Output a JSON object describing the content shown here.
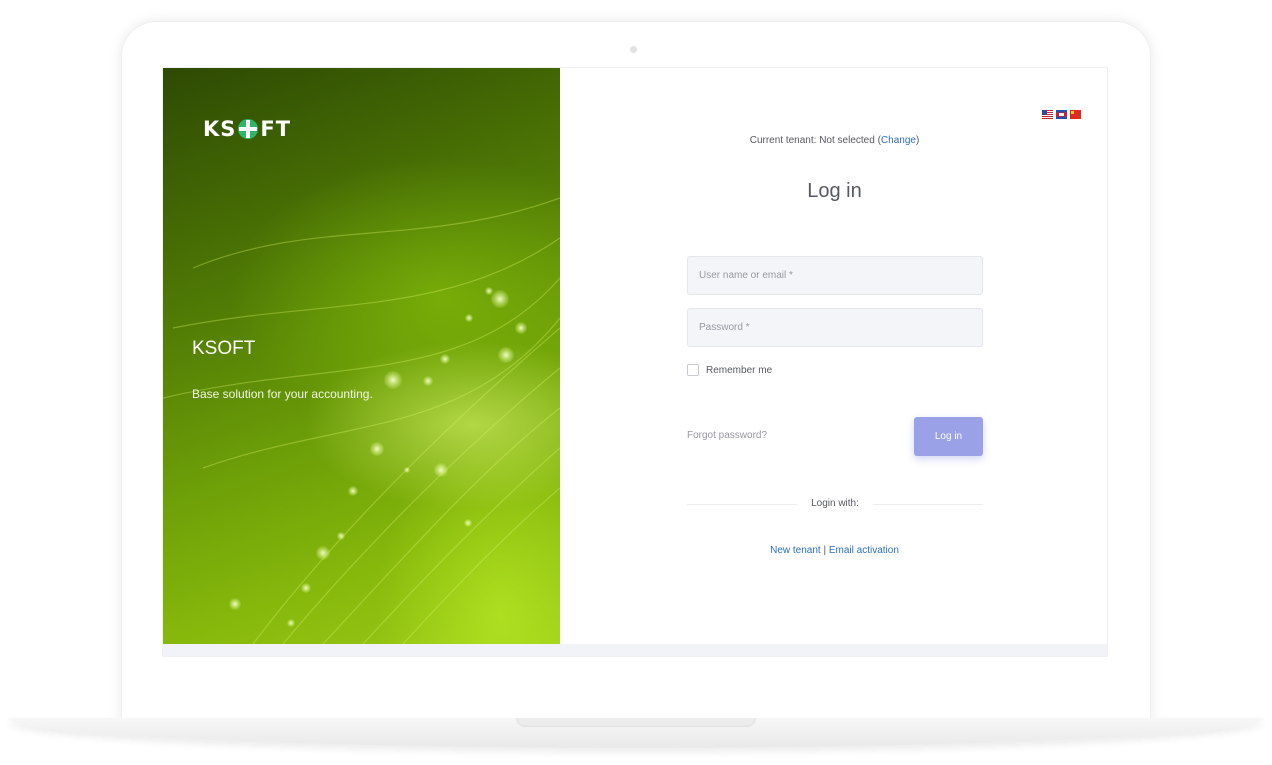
{
  "hero": {
    "logo_text_left": "KS",
    "logo_text_right": "FT",
    "title": "KSOFT",
    "subtitle": "Base solution for your accounting."
  },
  "languages": [
    "us-flag",
    "cambodia-flag",
    "china-flag"
  ],
  "tenant": {
    "prefix": "Current tenant: Not selected (",
    "change_link": "Change",
    "suffix": ")"
  },
  "form": {
    "heading": "Log in",
    "username_placeholder": "User name or email *",
    "password_placeholder": "Password *",
    "remember_label": "Remember me",
    "forgot_link": "Forgot password?",
    "submit_label": "Log in",
    "login_with_label": "Login with:"
  },
  "links": {
    "new_tenant": "New tenant",
    "separator": " | ",
    "email_activation": "Email activation"
  },
  "colors": {
    "primary_button": "#9aa1e6",
    "link": "#2d6fc1",
    "hero_green": "#6d9f08",
    "logo_accent": "#2fb56a"
  }
}
